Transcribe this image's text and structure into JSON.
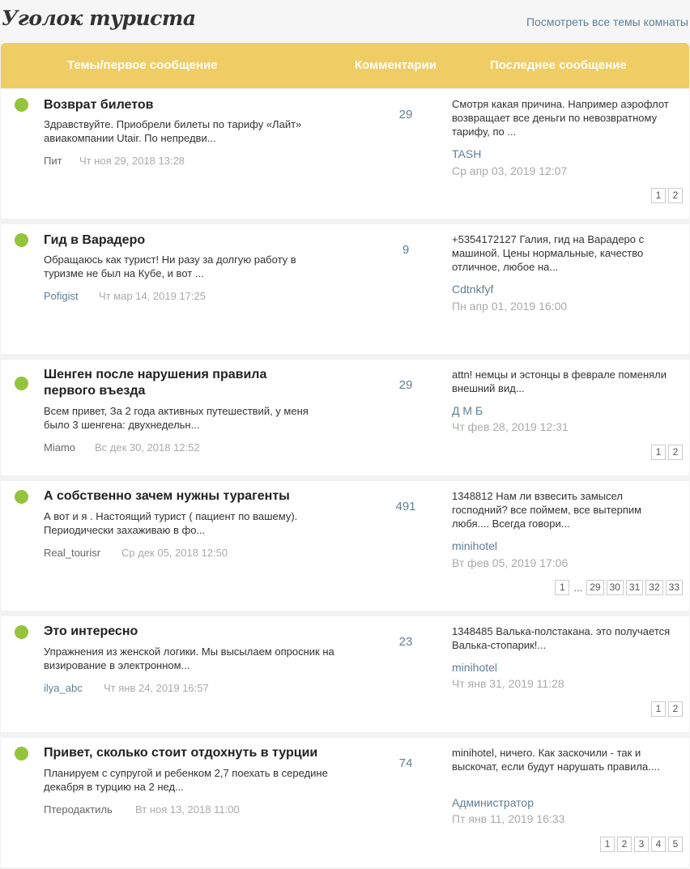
{
  "header": {
    "room_title": "Уголок туриста",
    "all_topics_link": "Посмотреть все темы комнаты",
    "col_topics": "Темы/первое сообщение",
    "col_comments": "Комментарии",
    "col_last": "Последнее сообщение"
  },
  "topics": [
    {
      "title": "Возврат билетов",
      "excerpt": "Здравствуйте. Приобрели билеты по тарифу «Лайт» авиакомпании Utair. По непредви...",
      "author": "Пит",
      "date": "Чт ноя 29, 2018 13:28",
      "comments": "29",
      "last_message": "Смотря какая причина. Например аэрофлот возвращает все деньги по невозвратному тарифу, по ...",
      "last_author": "TASH",
      "last_date": "Ср апр 03, 2019 12:07",
      "pages": [
        "1",
        "2"
      ]
    },
    {
      "title": "Гид в Варадеро",
      "excerpt": "Обращаюсь как турист! Ни разу за долгую работу в туризме не был на Кубе, и вот ...",
      "author": "Pofigist",
      "date": "Чт мар 14, 2019 17:25",
      "comments": "9",
      "last_message": "+5354172127 Галия, гид на Варадеро с машиной. Цены нормальные, качество отличное, любое на...",
      "last_author": "Cdtnkfyf",
      "last_date": "Пн апр 01, 2019 16:00",
      "pages": []
    },
    {
      "title": "Шенген после нарушения правила первого въезда",
      "excerpt": "Всем привет, За 2 года активных путешествий, у меня было 3 шенгена: двухнедельн...",
      "author": "Miamo",
      "date": "Вс дек 30, 2018 12:52",
      "comments": "29",
      "last_message": "attn! немцы и эстонцы в феврале поменяли внешний вид...",
      "last_author": "Д М Б",
      "last_date": "Чт фев 28, 2019 12:31",
      "pages": [
        "1",
        "2"
      ]
    },
    {
      "title": "А собственно зачем нужны турагенты",
      "excerpt": "А вот и я . Настоящий турист ( пациент по вашему). Периодически захаживаю в фо...",
      "author": "Real_tourisr",
      "date": "Ср дек 05, 2018 12:50",
      "comments": "491",
      "last_message": "1348812 Нам ли взвесить замысел господний? все поймем, все вытерпим любя.... Всегда говори...",
      "last_author": "minihotel",
      "last_date": "Вт фев 05, 2019 17:06",
      "pages": [
        "1",
        "...",
        "29",
        "30",
        "31",
        "32",
        "33"
      ]
    },
    {
      "title": "Это интересно",
      "excerpt": "Упражнения из женской логики. Мы высылаем опросник на визирование в электронном...",
      "author": "ilya_abc",
      "date": "Чт янв 24, 2019 16:57",
      "comments": "23",
      "last_message": "1348485 Валька-полстакана. это получается Валька-стопарик!...",
      "last_author": "minihotel",
      "last_date": "Чт янв 31, 2019 11:28",
      "pages": [
        "1",
        "2"
      ]
    },
    {
      "title": "Привет, сколько стоит отдохнуть в турции",
      "excerpt": "Планируем с супругой и ребенком 2,7 поехать в середине декабря в турцию на 2 нед...",
      "author": "Птеродактиль",
      "date": "Вт ноя 13, 2018 11:00",
      "comments": "74",
      "last_message": "minihotel, ничего. Как заскочили - так и выскочат, если будут нарушать правила....",
      "last_author": "Администратор",
      "last_date": "Пт янв 11, 2019 16:33",
      "pages": [
        "1",
        "2",
        "3",
        "4",
        "5"
      ]
    }
  ],
  "colors": {
    "header_bg": "#f0cc64",
    "status_dot": "#94c43c",
    "link": "#5f7f98"
  }
}
